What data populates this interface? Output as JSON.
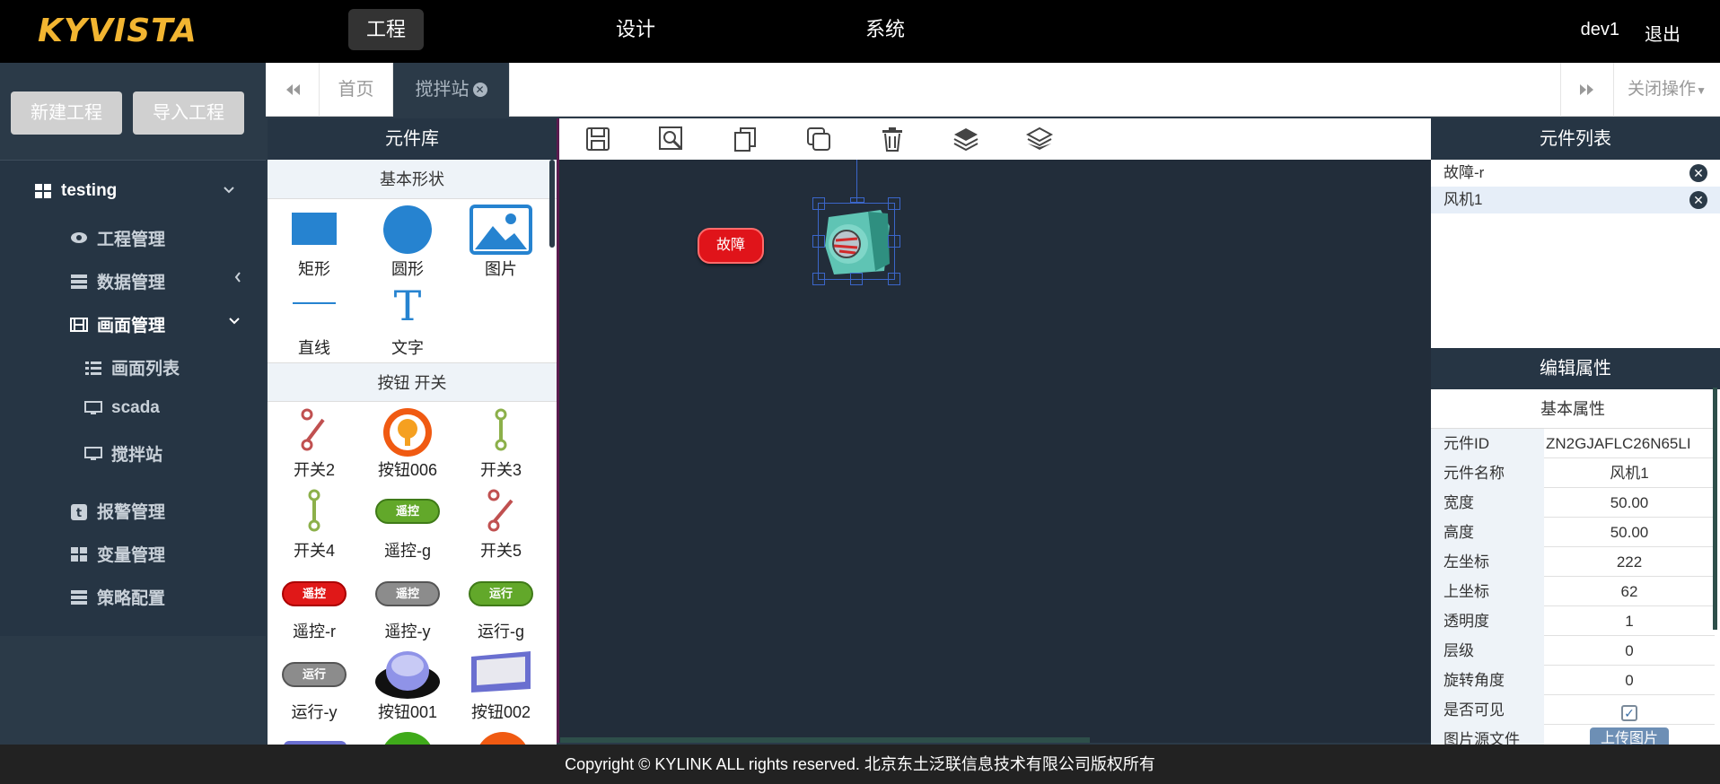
{
  "header": {
    "logo": "KYVISTA",
    "nav": [
      "工程",
      "设计",
      "系统"
    ],
    "active_nav": "工程",
    "user": "dev1",
    "logout": "退出"
  },
  "sidebar": {
    "new_project": "新建工程",
    "import_project": "导入工程",
    "project": "testing",
    "items": [
      {
        "label": "工程管理",
        "icon": "eye-icon"
      },
      {
        "label": "数据管理",
        "icon": "server-icon"
      },
      {
        "label": "画面管理",
        "icon": "film-icon"
      },
      {
        "label": "画面列表",
        "icon": "list-icon"
      },
      {
        "label": "scada",
        "icon": "monitor-icon"
      },
      {
        "label": "搅拌站",
        "icon": "monitor-icon"
      },
      {
        "label": "报警管理",
        "icon": "t-icon"
      },
      {
        "label": "变量管理",
        "icon": "grid-icon"
      },
      {
        "label": "策略配置",
        "icon": "server-icon"
      }
    ]
  },
  "tabs": {
    "home": "首页",
    "active": "搅拌站",
    "close_ops": "关闭操作"
  },
  "library": {
    "title": "元件库",
    "group1": "基本形状",
    "shapes": [
      "矩形",
      "圆形",
      "图片",
      "直线",
      "文字"
    ],
    "group2": "按钮 开关",
    "buttons": [
      "开关2",
      "按钮006",
      "开关3",
      "开关4",
      "遥控-g",
      "开关5",
      "遥控-r",
      "遥控-y",
      "运行-g",
      "运行-y",
      "按钮001",
      "按钮002"
    ],
    "pill_remote": "遥控",
    "pill_run": "运行"
  },
  "canvas": {
    "fault_label": "故障"
  },
  "component_list": {
    "title": "元件列表",
    "items": [
      "故障-r",
      "风机1"
    ]
  },
  "properties": {
    "title": "编辑属性",
    "section": "基本属性",
    "rows": [
      {
        "k": "元件ID",
        "v": "ZN2GJAFLC26N65LI"
      },
      {
        "k": "元件名称",
        "v": "风机1"
      },
      {
        "k": "宽度",
        "v": "50.00"
      },
      {
        "k": "高度",
        "v": "50.00"
      },
      {
        "k": "左坐标",
        "v": "222"
      },
      {
        "k": "上坐标",
        "v": "62"
      },
      {
        "k": "透明度",
        "v": "1"
      },
      {
        "k": "层级",
        "v": "0"
      },
      {
        "k": "旋转角度",
        "v": "0"
      },
      {
        "k": "是否可见",
        "v": ""
      },
      {
        "k": "图片源文件",
        "v": "上传图片"
      }
    ]
  },
  "footer": "Copyright © KYLINK ALL rights reserved. 北京东土泛联信息技术有限公司版权所有"
}
